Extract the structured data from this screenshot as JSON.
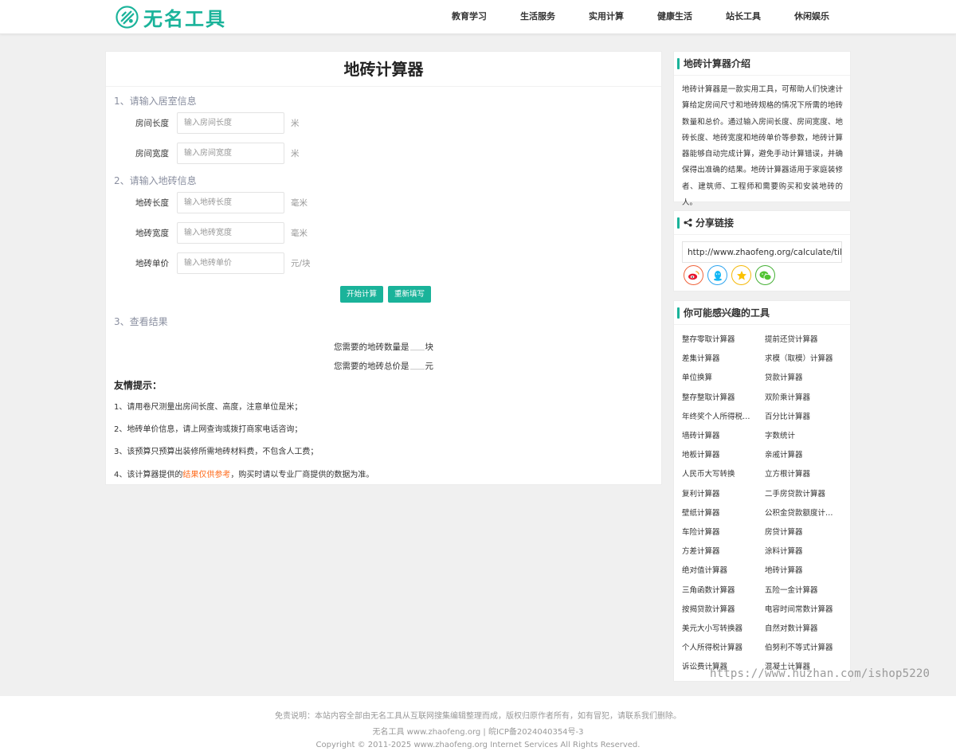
{
  "header": {
    "logo_text": "无名工具",
    "nav": [
      "教育学习",
      "生活服务",
      "实用计算",
      "健康生活",
      "站长工具",
      "休闲娱乐"
    ]
  },
  "main": {
    "title": "地砖计算器",
    "section1": "1、请输入居室信息",
    "section2": "2、请输入地砖信息",
    "section3": "3、查看结果",
    "fields": [
      {
        "label": "房间长度",
        "placeholder": "输入房间长度",
        "unit": "米"
      },
      {
        "label": "房间宽度",
        "placeholder": "输入房间宽度",
        "unit": "米"
      },
      {
        "label": "地砖长度",
        "placeholder": "输入地砖长度",
        "unit": "毫米"
      },
      {
        "label": "地砖宽度",
        "placeholder": "输入地砖宽度",
        "unit": "毫米"
      },
      {
        "label": "地砖单价",
        "placeholder": "输入地砖单价",
        "unit": "元/块"
      }
    ],
    "btn_calc": "开始计算",
    "btn_reset": "重新填写",
    "result_count_prefix": "您需要的地砖数量是",
    "result_count_unit": "块",
    "result_price_prefix": "您需要的地砖总价是",
    "result_price_unit": "元",
    "tips_title": "友情提示：",
    "tips": [
      "1、请用卷尺测量出房间长度、高度，注意单位是米；",
      "2、地砖单价信息，请上网查询或拨打商家电话咨询；",
      "3、该预算只预算出装修所需地砖材料费，不包含人工费；"
    ],
    "tip4_pre": "4、该计算器提供的",
    "tip4_hl": "结果仅供参考",
    "tip4_post": "，购买时请以专业厂商提供的数据为准。"
  },
  "intro": {
    "title": "地砖计算器介绍",
    "text": "地砖计算器是一款实用工具，可帮助人们快速计算给定房间尺寸和地砖规格的情况下所需的地砖数量和总价。通过输入房间长度、房间宽度、地砖长度、地砖宽度和地砖单价等参数，地砖计算器能够自动完成计算，避免手动计算错误，并确保得出准确的结果。地砖计算器适用于家庭装修者、建筑师、工程师和需要购买和安装地砖的人。"
  },
  "share": {
    "title": "分享链接",
    "url": "http://www.zhaofeng.org/calculate/tiles.html",
    "icons": [
      "weibo-icon",
      "qq-icon",
      "qzone-icon",
      "wechat-icon"
    ]
  },
  "tools": {
    "title": "你可能感兴趣的工具",
    "items": [
      "整存零取计算器",
      "提前还贷计算器",
      "差集计算器",
      "求模（取模）计算器",
      "单位换算",
      "贷款计算器",
      "整存整取计算器",
      "双阶乘计算器",
      "年终奖个人所得税计算器",
      "百分比计算器",
      "墙砖计算器",
      "字数统计",
      "地板计算器",
      "亲戚计算器",
      "人民币大写转换",
      "立方根计算器",
      "复利计算器",
      "二手房贷款计算器",
      "壁纸计算器",
      "公积金贷款额度计算器",
      "车险计算器",
      "房贷计算器",
      "方差计算器",
      "涂料计算器",
      "绝对值计算器",
      "地砖计算器",
      "三角函数计算器",
      "五险一金计算器",
      "按揭贷款计算器",
      "电容时间常数计算器",
      "美元大小写转换器",
      "自然对数计算器",
      "个人所得税计算器",
      "伯努利不等式计算器",
      "诉讼费计算器",
      "混凝土计算器"
    ]
  },
  "footer": {
    "line1": "免责说明：本站内容全部由无名工具从互联网搜集编辑整理而成，版权归原作者所有，如有冒犯，请联系我们删除。",
    "line2": "无名工具 www.zhaofeng.org | 皖ICP备2024040354号-3",
    "line3": "Copyright © 2011-2025 www.zhaofeng.org Internet Services All Rights Reserved."
  },
  "watermark": "https://www.huzhan.com/ishop5220",
  "colors": {
    "accent": "#1ab39a",
    "highlight": "#ff6a1a"
  }
}
